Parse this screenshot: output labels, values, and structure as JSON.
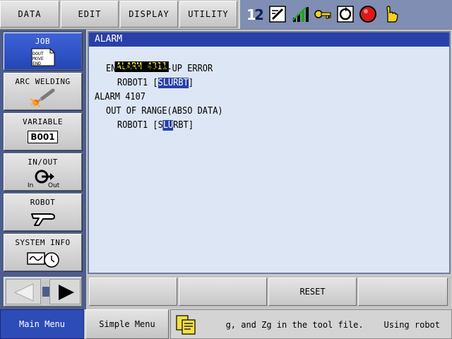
{
  "top_menu": {
    "data": "DATA",
    "edit": "EDIT",
    "display": "DISPLAY",
    "utility": "UTILITY"
  },
  "status_icons": [
    "control-group-icon",
    "edit-mode-icon",
    "speed-level-icon",
    "security-key-icon",
    "cycle-mode-icon",
    "servo-stop-icon",
    "hand-pointer-icon"
  ],
  "left_panel": {
    "items": [
      {
        "label": "JOB",
        "icon": "job-document-icon",
        "icon_text": [
          "DOUT",
          "MOVE",
          "END"
        ]
      },
      {
        "label": "ARC WELDING",
        "icon": "arc-welding-torch-icon"
      },
      {
        "label": "VARIABLE",
        "icon": "variable-box-icon",
        "icon_text": "B001"
      },
      {
        "label": "IN/OUT",
        "icon": "io-arrow-icon",
        "icon_in": "In",
        "icon_out": "Out"
      },
      {
        "label": "ROBOT",
        "icon": "robot-arm-icon"
      },
      {
        "label": "SYSTEM INFO",
        "icon": "system-info-clock-icon"
      }
    ]
  },
  "main": {
    "title": "ALARM",
    "alarm1": {
      "code": "ALARM 4311",
      "message": "ENCODER BACK-UP ERROR",
      "robot_prefix": "ROBOT1 [",
      "axes": "SLURBT",
      "robot_suffix": "]"
    },
    "alarm2": {
      "code": "ALARM 4107",
      "message": "OUT OF RANGE(ABSO DATA)",
      "robot_prefix": "ROBOT1 [",
      "axis_pre": "S",
      "axis_hl": "LU",
      "axis_post": "RBT",
      "robot_suffix": "]"
    }
  },
  "softkeys": [
    "",
    "",
    "RESET",
    ""
  ],
  "bottom": {
    "main_menu": "Main Menu",
    "simple_menu": "Simple Menu",
    "message": "g, and Zg in the tool file.    Using robot"
  },
  "colors": {
    "title_bar": "#2840a8",
    "alarm_highlight_bg": "#000000",
    "alarm_highlight_fg": "#ffff40",
    "side_panel": "#4d5e8c",
    "active_button": "#2d4cb8"
  }
}
